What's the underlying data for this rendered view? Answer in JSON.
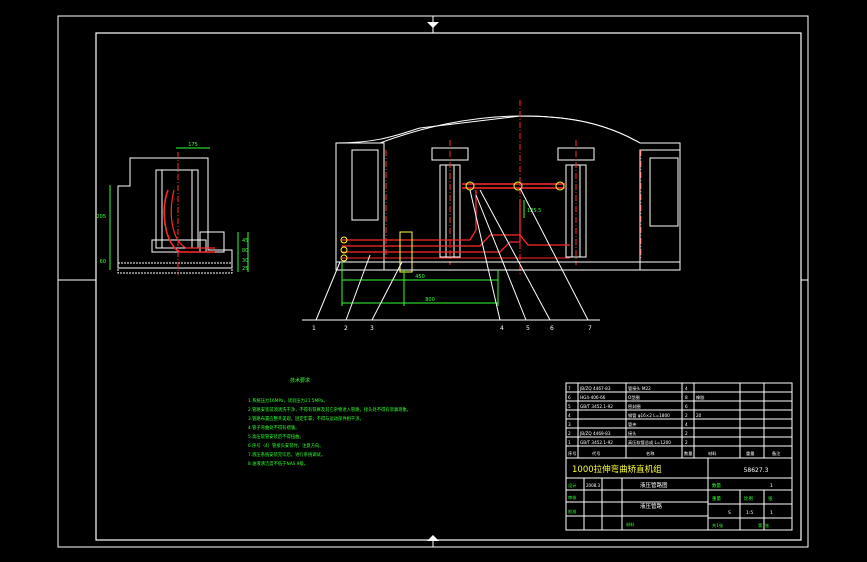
{
  "colors": {
    "background": "#000000",
    "frame": "#ffffff",
    "hydraulic": "#ff2a2a",
    "dimension": "#33ff33",
    "leader": "#ffffff",
    "cyan": "#00e5ff",
    "yellow": "#ffff33"
  },
  "side_view": {
    "dim_top": "175",
    "dim_left_upper": "205",
    "dim_left_lower": "60",
    "dim_right_1": "45",
    "dim_right_2": "80",
    "dim_right_3": "30",
    "dim_right_4": "25"
  },
  "front_view": {
    "dim_upper": "450",
    "dim_lower": "800",
    "dim_small": "125.5"
  },
  "callouts": [
    "1",
    "2",
    "3",
    "4",
    "5",
    "6",
    "7"
  ],
  "notes": {
    "heading": "技术要求",
    "lines": [
      "1.系统压力16MPa，试验压力21.5MPa。",
      "2.管路安装前须清洗干净，不得有铁屑及其它杂物进入管路，接头处不得有渗漏现象。",
      "3.管路布置应整齐美观，固定牢靠，不得与运动部件相干涉。",
      "4.管子弯曲处不得有褶皱。",
      "5.高压软管安装后不得扭曲。",
      "6.序号（4）管接头安装时，注意方向。",
      "7.液压系统安装完毕后，进行系统调试。",
      "8.油液清洁度不低于NAS 9级。"
    ]
  },
  "parts_list": {
    "rows": [
      {
        "no": "7",
        "code": "JB/ZQ 4467-83",
        "name": "管接头 M22",
        "qty": "4",
        "material": "",
        "weight": "",
        "remark": ""
      },
      {
        "no": "6",
        "code": "HG4-406-66",
        "name": "O型圈",
        "qty": "8",
        "material": "橡胶",
        "weight": "",
        "remark": ""
      },
      {
        "no": "5",
        "code": "GB/T 3452.1-92",
        "name": "密封圈",
        "qty": "6",
        "material": "",
        "weight": "",
        "remark": ""
      },
      {
        "no": "4",
        "code": "",
        "name": "钢管 φ16×2 L=1800",
        "qty": "2",
        "material": "20",
        "weight": "",
        "remark": ""
      },
      {
        "no": "3",
        "code": "",
        "name": "管夹",
        "qty": "4",
        "material": "",
        "weight": "",
        "remark": ""
      },
      {
        "no": "2",
        "code": "JB/ZQ 4469-83",
        "name": "接头",
        "qty": "2",
        "material": "",
        "weight": "",
        "remark": ""
      },
      {
        "no": "1",
        "code": "GB/T 3452.1-92",
        "name": "高压软管总成 L=1200",
        "qty": "2",
        "material": "",
        "weight": "",
        "remark": ""
      }
    ],
    "header": {
      "no": "序号",
      "code": "代号",
      "name": "名称",
      "qty": "数量",
      "material": "材料",
      "weight": "重量",
      "remark": "备注"
    }
  },
  "title_block": {
    "project": "1000拉伸弯曲矫直机组",
    "drawing_no": "58627.3",
    "assembly": "液压管路图",
    "part_title": "液压管路",
    "designer": "设计",
    "checker": "审核",
    "approver": "批准",
    "date": "2008.3",
    "scale_label": "比例",
    "scale": "1:5",
    "weight_label": "重量",
    "sheet_label": "张",
    "sheet": "1",
    "total_sheets": "共1张",
    "quantity_label": "数量",
    "quantity": "1",
    "material_label": "材料",
    "stage": "S",
    "sheet_no": "第1张"
  }
}
